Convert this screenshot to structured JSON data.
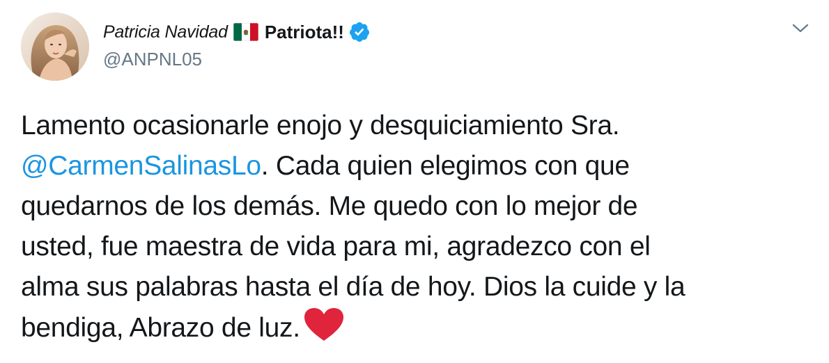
{
  "tweet": {
    "author": {
      "display_name": "Patricia Navidad",
      "flag_icon": "mexico-flag-emoji",
      "name_suffix": "Patriota!!",
      "verified_icon": "verified-badge-icon",
      "handle": "@ANPNL05"
    },
    "menu_icon": "chevron-down-icon",
    "text": {
      "line1": "Lamento ocasionarle enojo y desquiciamiento Sra.",
      "mention": "@CarmenSalinasLo",
      "line2_rest": ". Cada quien elegimos con que",
      "line3": "quedarnos de los demás. Me quedo con lo mejor de",
      "line4": "usted, fue maestra de vida para mi, agradezco con el",
      "line5": "alma sus palabras hasta el día de hoy. Dios la cuide y la",
      "line6": "bendiga, Abrazo de luz.",
      "trailing_emoji": "red-heart-emoji"
    },
    "colors": {
      "text": "#14171a",
      "handle": "#657786",
      "mention": "#1b95e0",
      "verified": "#1da1f2",
      "heart": "#e0243c"
    }
  }
}
